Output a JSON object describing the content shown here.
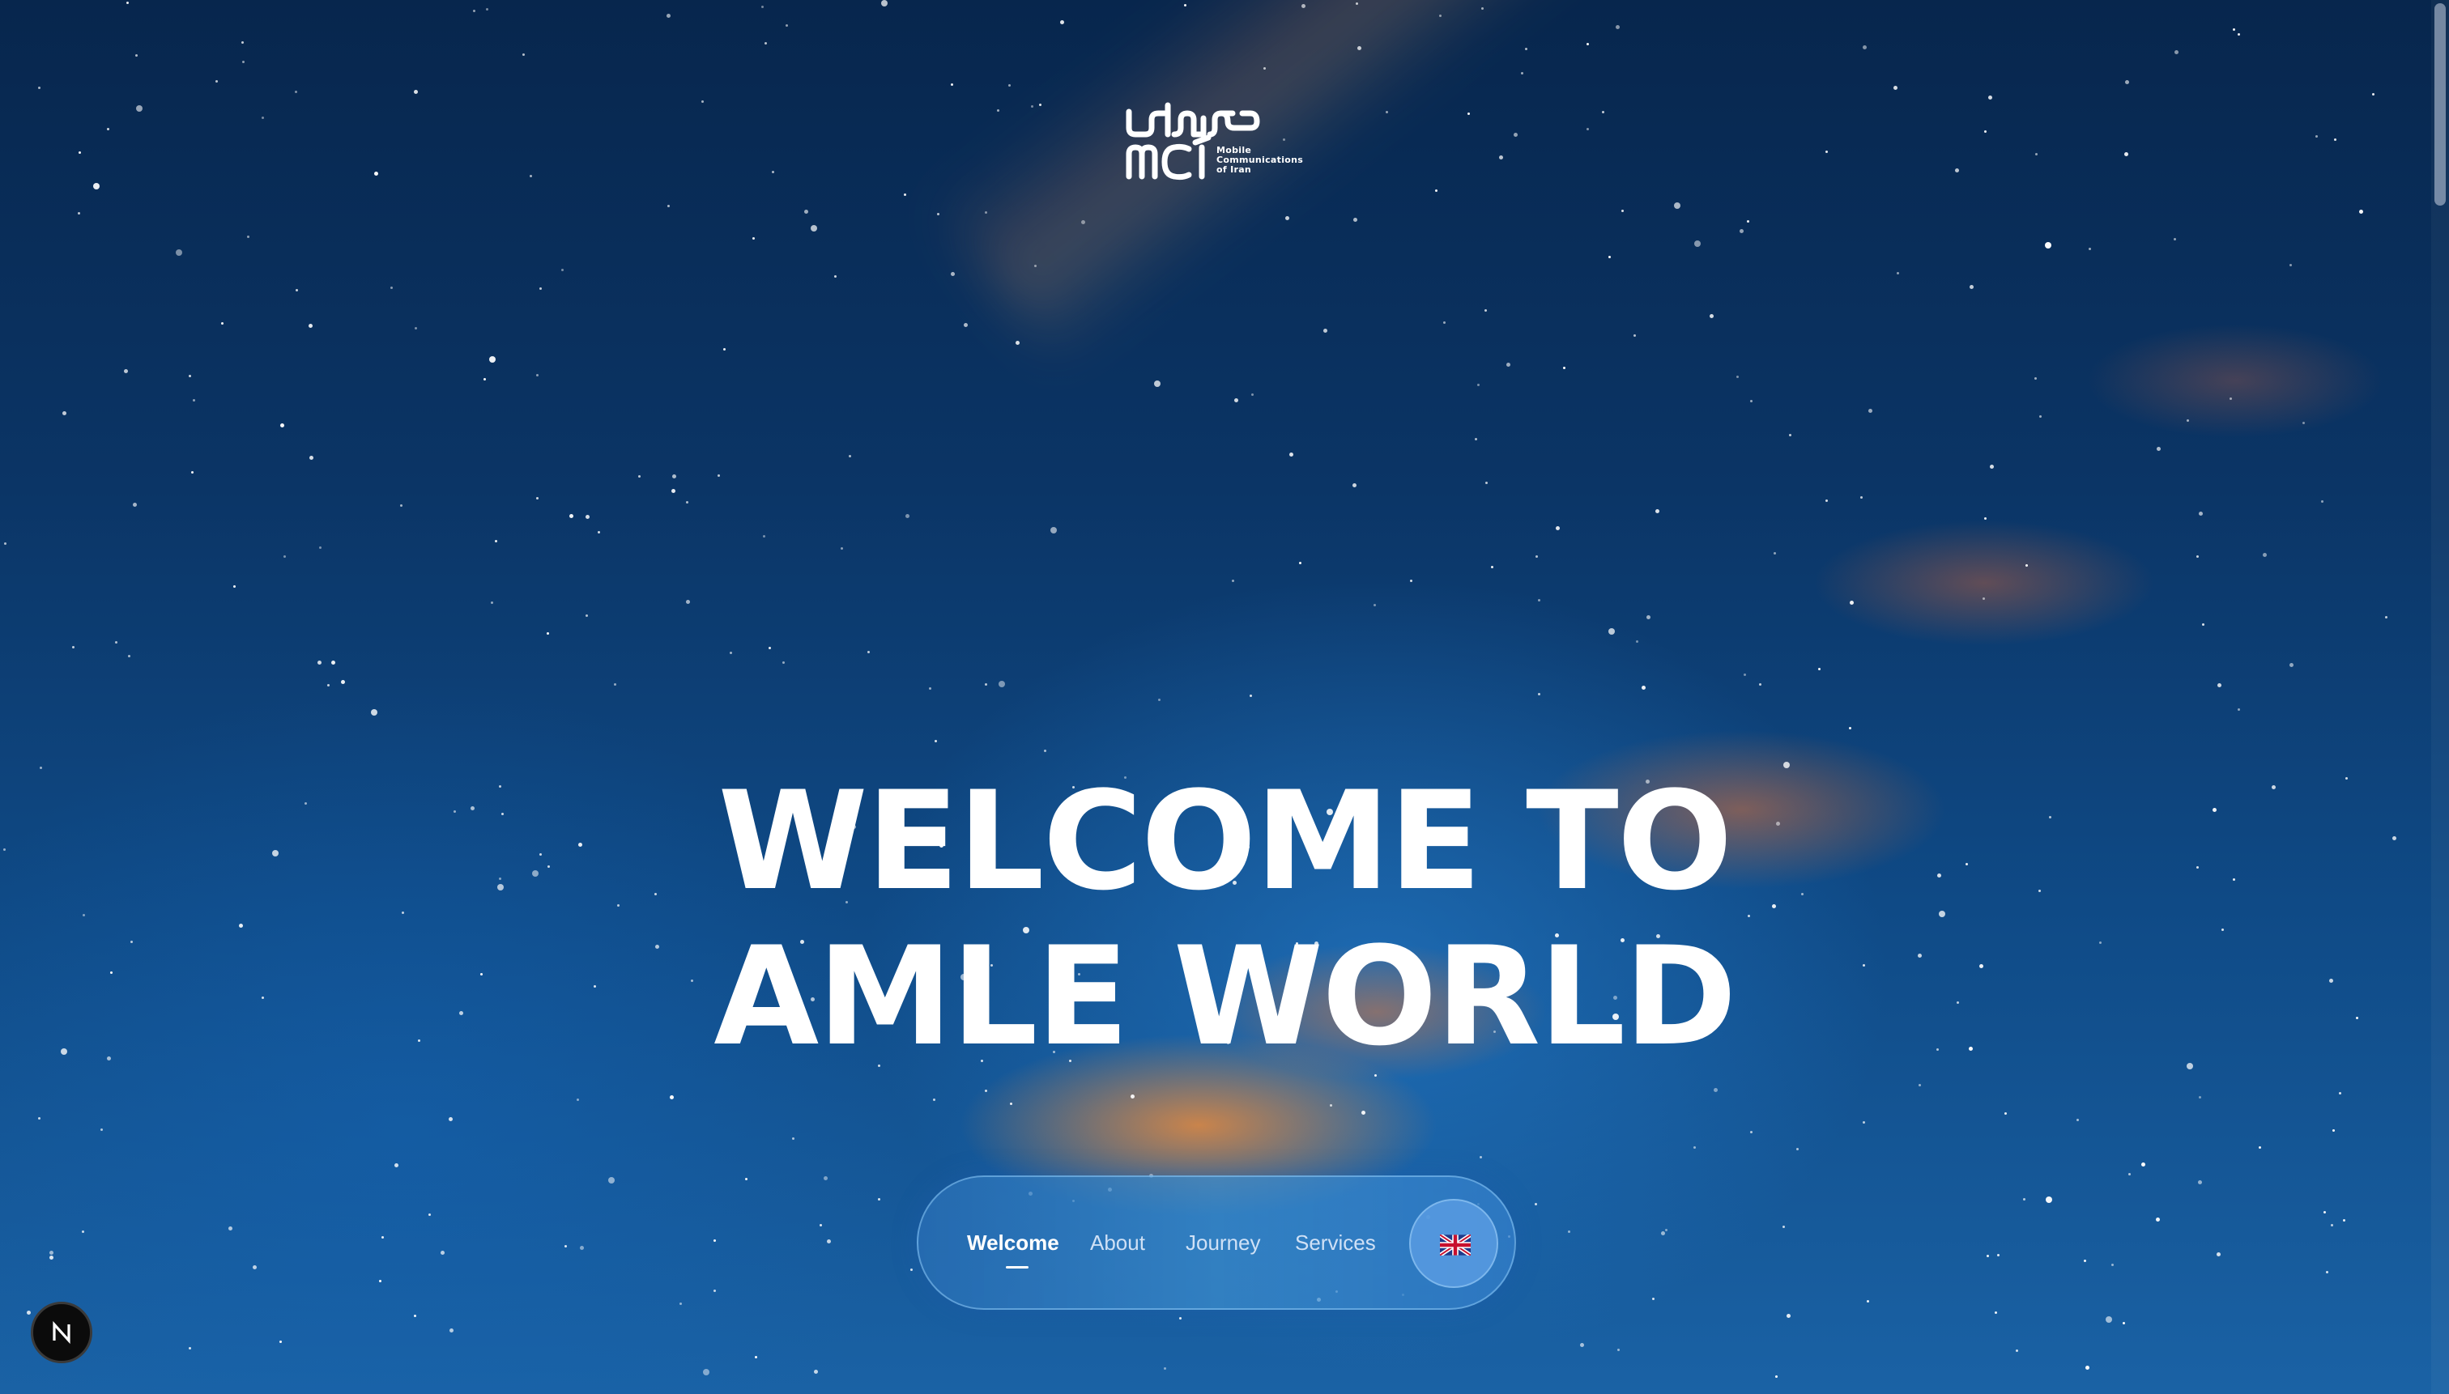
{
  "logo": {
    "alt": "همراه اول mci",
    "arabic_wordmark": "همراه اول",
    "latin_wordmark": "mci",
    "subtitle_lines": [
      "Mobile",
      "Communications",
      "of Iran"
    ]
  },
  "hero": {
    "line1": "WELCOME TO",
    "line2": "AMLE WORLD"
  },
  "nav": {
    "items": [
      {
        "label": "Welcome",
        "active": true
      },
      {
        "label": "About",
        "active": false
      },
      {
        "label": "Journey",
        "active": false
      },
      {
        "label": "Services",
        "active": false
      }
    ],
    "language_icon": "uk-flag-icon"
  },
  "devtools": {
    "badge_letter": "N",
    "icon": "nextjs-icon"
  },
  "colors": {
    "text": "#ffffff",
    "sky_top": "#07264d",
    "sky_bottom": "#1a62a5",
    "nebula": "#e88a3c"
  }
}
